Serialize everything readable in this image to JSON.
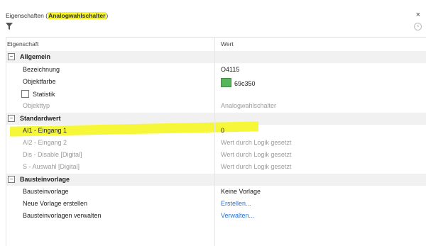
{
  "panel": {
    "title_prefix": "Eigenschaften (",
    "title_highlight": "Analogwahlschalter",
    "title_suffix": ")",
    "close_label": "×",
    "clear_label": "×"
  },
  "header": {
    "col_property": "Eigenschaft",
    "col_value": "Wert"
  },
  "categories": {
    "allgemein": {
      "toggle": "−",
      "label": "Allgemein"
    },
    "standardwert": {
      "toggle": "−",
      "label": "Standardwert"
    },
    "bausteinvorlage": {
      "toggle": "−",
      "label": "Bausteinvorlage"
    }
  },
  "rows": {
    "bezeichnung": {
      "label": "Bezeichnung",
      "value": "O4115"
    },
    "objektfarbe": {
      "label": "Objektfarbe",
      "value": "69c350",
      "color": "#57b55a"
    },
    "statistik": {
      "label": "Statistik",
      "value": ""
    },
    "objekttyp": {
      "label": "Objekttyp",
      "value": "Analogwahlschalter"
    },
    "ai1": {
      "label": "AI1 - Eingang 1",
      "value": "0"
    },
    "ai2": {
      "label": "AI2 - Eingang 2",
      "value": "Wert durch Logik gesetzt"
    },
    "dis": {
      "label": "Dis - Disable [Digital]",
      "value": "Wert durch Logik gesetzt"
    },
    "s": {
      "label": "S - Auswahl [Digital]",
      "value": "Wert durch Logik gesetzt"
    },
    "vorlage": {
      "label": "Bausteinvorlage",
      "value": "Keine Vorlage"
    },
    "neue_vorlage": {
      "label": "Neue Vorlage erstellen",
      "value": "Erstellen..."
    },
    "verwalten": {
      "label": "Bausteinvorlagen verwalten",
      "value": "Verwalten..."
    }
  },
  "colors": {
    "highlight": "#f7f73a",
    "link": "#2a6fd1",
    "swatch": "#57b55a"
  }
}
